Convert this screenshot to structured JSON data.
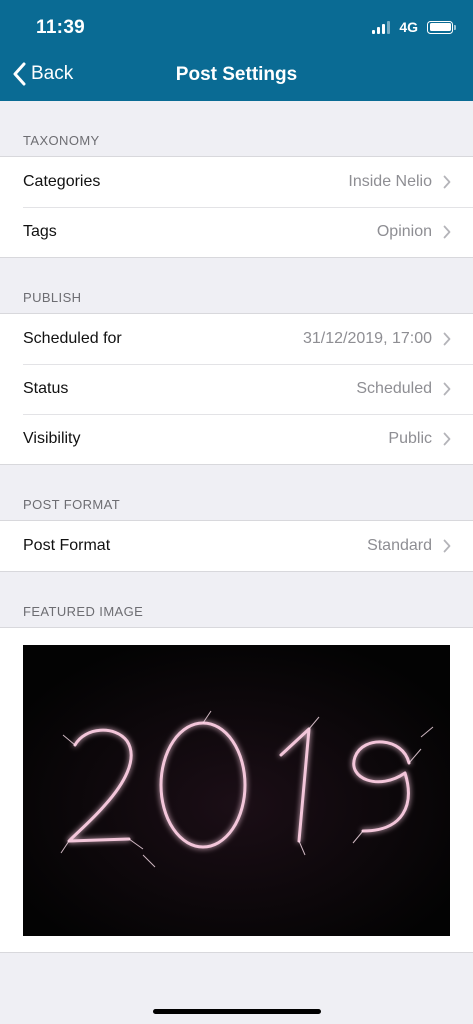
{
  "status_bar": {
    "time": "11:39",
    "network": "4G"
  },
  "nav": {
    "back_label": "Back",
    "title": "Post Settings"
  },
  "sections": {
    "taxonomy": {
      "header": "TAXONOMY",
      "rows": [
        {
          "label": "Categories",
          "value": "Inside Nelio"
        },
        {
          "label": "Tags",
          "value": "Opinion"
        }
      ]
    },
    "publish": {
      "header": "PUBLISH",
      "rows": [
        {
          "label": "Scheduled for",
          "value": "31/12/2019, 17:00"
        },
        {
          "label": "Status",
          "value": "Scheduled"
        },
        {
          "label": "Visibility",
          "value": "Public"
        }
      ]
    },
    "post_format": {
      "header": "POST FORMAT",
      "rows": [
        {
          "label": "Post Format",
          "value": "Standard"
        }
      ]
    },
    "featured_image": {
      "header": "FEATURED IMAGE",
      "image_text": "2019"
    }
  },
  "colors": {
    "header_bg": "#0a6b94",
    "page_bg": "#efeff4",
    "value_gray": "#8e8e93",
    "sparkler": "#f3c6da"
  }
}
